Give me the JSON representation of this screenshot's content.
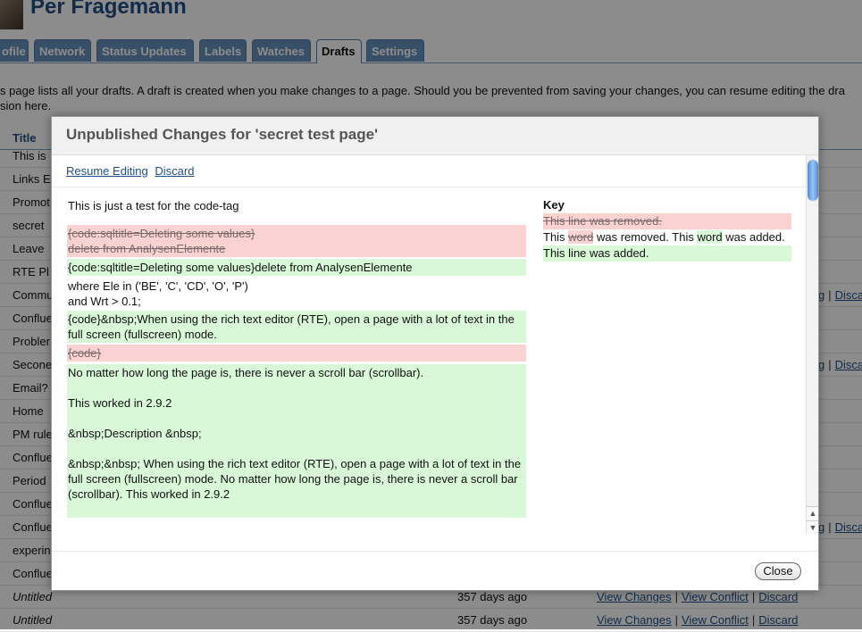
{
  "profile": {
    "name": "Per Fragemann"
  },
  "tabs": [
    "ofile",
    "Network",
    "Status Updates",
    "Labels",
    "Watches",
    "Drafts",
    "Settings"
  ],
  "active_tab": "Drafts",
  "intro": {
    "line1": "s page lists all your drafts. A draft is created when you make changes to a page. Should you be prevented from saving your changes, you can resume editing the dra",
    "line2": "sion here."
  },
  "table": {
    "title_header": "Title",
    "rows": [
      {
        "title": "This is"
      },
      {
        "title": "Links E"
      },
      {
        "title": "Promot"
      },
      {
        "title": "secret"
      },
      {
        "title": "Leave"
      },
      {
        "title": "RTE Pl"
      },
      {
        "title": "Commu",
        "edge_link": "g",
        "edge_discard": "Disca"
      },
      {
        "title": "Conflue"
      },
      {
        "title": "Probler"
      },
      {
        "title": "Secone",
        "edge_link": "g",
        "edge_discard": "Disca"
      },
      {
        "title": "Email?"
      },
      {
        "title": "Home"
      },
      {
        "title": "PM rule"
      },
      {
        "title": "Conflue"
      },
      {
        "title": "Period"
      },
      {
        "title": "Conflue"
      },
      {
        "title": "Conflue",
        "edge_link": "g",
        "edge_discard": "Disca"
      },
      {
        "title": "experin"
      },
      {
        "title": "Conflue"
      },
      {
        "title": "Untitled",
        "age": "357 days ago",
        "view_changes": "View Changes",
        "view_conflict": "View Conflict",
        "discard": "Discard",
        "italic": true
      },
      {
        "title": "Untitled",
        "age": "357 days ago",
        "view_changes": "View Changes",
        "view_conflict": "View Conflict",
        "discard": "Discard",
        "italic": true
      }
    ]
  },
  "dialog": {
    "title": "Unpublished Changes for 'secret test page'",
    "resume_label": "Resume Editing",
    "discard_label": "Discard",
    "close_label": "Close",
    "diff": [
      {
        "type": "plain",
        "lines": [
          "This is just a test for the code-tag"
        ]
      },
      {
        "type": "removed",
        "lines": [
          "{code:sqltitle=Deleting some values}",
          "delete from AnalysenElemente"
        ]
      },
      {
        "type": "added",
        "lines": [
          "{code:sqltitle=Deleting some values}delete from AnalysenElemente"
        ]
      },
      {
        "type": "plain",
        "lines": [
          "where Ele in ('BE', 'C', 'CD', 'O', 'P')",
          "and Wrt > 0.1;"
        ]
      },
      {
        "type": "added",
        "lines": [
          "{code}&nbsp;When using the rich text editor (RTE), open a page with a lot of text in the full screen (fullscreen) mode."
        ]
      },
      {
        "type": "removed",
        "lines": [
          "{code}"
        ]
      },
      {
        "type": "added",
        "lines": [
          "No matter how long the page is, there is never a scroll bar (scrollbar).",
          "",
          "This worked in 2.9.2",
          "",
          "&nbsp;Description &nbsp;",
          "",
          "&nbsp;&nbsp; When using the rich text editor (RTE), open a page with a lot of text in the full screen (fullscreen) mode. No matter how long the page is, there is never a scroll bar (scrollbar). This worked in 2.9.2",
          ""
        ]
      }
    ],
    "key": {
      "heading": "Key",
      "removed_line": "This line was removed.",
      "word_prefix": "This ",
      "word_removed": "word",
      "word_mid": " was removed. This ",
      "word_added": "word",
      "word_suffix": " was added.",
      "added_line": "This line was added."
    }
  },
  "scroll_up_glyph": "▲",
  "scroll_down_glyph": "▼"
}
